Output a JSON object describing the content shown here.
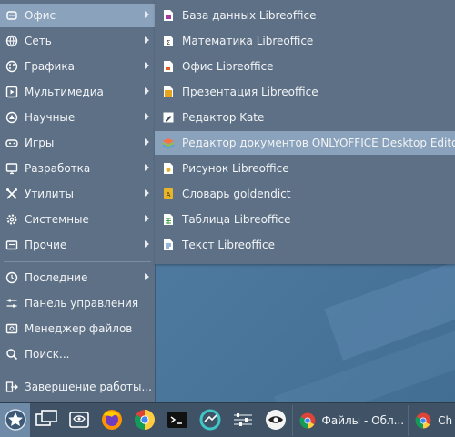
{
  "menu": {
    "categories": [
      {
        "label": "Офис",
        "icon": "office-icon",
        "active": true
      },
      {
        "label": "Сеть",
        "icon": "globe-icon"
      },
      {
        "label": "Графика",
        "icon": "palette-icon"
      },
      {
        "label": "Мультимедиа",
        "icon": "play-icon"
      },
      {
        "label": "Научные",
        "icon": "science-icon"
      },
      {
        "label": "Игры",
        "icon": "gamepad-icon"
      },
      {
        "label": "Разработка",
        "icon": "monitor-icon"
      },
      {
        "label": "Утилиты",
        "icon": "tools-icon"
      },
      {
        "label": "Системные",
        "icon": "gear-icon"
      },
      {
        "label": "Прочие",
        "icon": "folder-icon"
      }
    ],
    "places": [
      {
        "label": "Последние",
        "icon": "clock-icon"
      },
      {
        "label": "Панель управления",
        "icon": "sliders-icon"
      },
      {
        "label": "Менеджер файлов",
        "icon": "file-manager-icon"
      },
      {
        "label": "Поиск...",
        "icon": "search-icon"
      }
    ],
    "shutdown": {
      "label": "Завершение работы...",
      "icon": "logout-icon"
    }
  },
  "submenu": {
    "items": [
      {
        "label": "База данных Libreoffice",
        "icon": "libreoffice-base-icon",
        "color": "#a33e9e"
      },
      {
        "label": "Математика Libreoffice",
        "icon": "libreoffice-math-icon",
        "color": "#ffffff"
      },
      {
        "label": "Офис Libreoffice",
        "icon": "libreoffice-icon",
        "color": "#ffffff"
      },
      {
        "label": "Презентация Libreoffice",
        "icon": "libreoffice-impress-icon",
        "color": "#e8a31c"
      },
      {
        "label": "Редактор Kate",
        "icon": "kate-icon",
        "color": "#ffffff"
      },
      {
        "label": "Редактор документов ONLYOFFICE Desktop Editors",
        "icon": "onlyoffice-icon",
        "color": "#ff6f3d",
        "active": true
      },
      {
        "label": "Рисунок Libreoffice",
        "icon": "libreoffice-draw-icon",
        "color": "#e0b42c"
      },
      {
        "label": "Словарь goldendict",
        "icon": "goldendict-icon",
        "color": "#e8b52a"
      },
      {
        "label": "Таблица Libreoffice",
        "icon": "libreoffice-calc-icon",
        "color": "#ffffff"
      },
      {
        "label": "Текст Libreoffice",
        "icon": "libreoffice-writer-icon",
        "color": "#ffffff"
      }
    ]
  },
  "taskbar": {
    "launchers": [
      "start-menu-icon",
      "window-switcher-icon",
      "file-manager-icon",
      "firefox-icon",
      "chrome-icon",
      "terminal-icon",
      "network-icon",
      "mixer-icon",
      "eye-icon"
    ],
    "tasks": [
      {
        "label": "Файлы - Обл...",
        "icon": "chrome-icon"
      },
      {
        "label": "Ch",
        "icon": "chrome-icon"
      }
    ]
  },
  "colors": {
    "menu_bg": "#5d7086",
    "highlight": "#8aa2bb",
    "desktop": "#5e88ad",
    "taskbar": "#3f5266"
  }
}
